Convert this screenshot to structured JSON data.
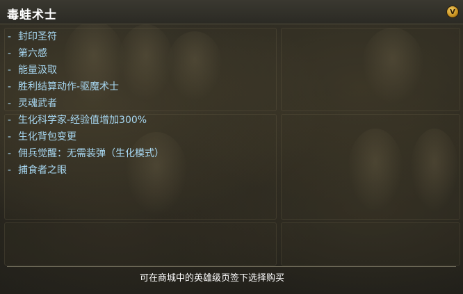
{
  "title": "毒蛙术士",
  "badge": "V",
  "features": [
    "封印圣符",
    "第六感",
    "能量汲取",
    "胜利结算动作-驱魔术士",
    "灵魂武者",
    "生化科学家-经验值增加300%",
    "生化背包变更",
    "佣兵觉醒：无需装弹（生化模式）",
    "捕食者之眼"
  ],
  "bullet": "-",
  "footer": "可在商城中的英雄级页签下选择购买",
  "colors": {
    "title": "#ffffff",
    "feature_text": "#a8d8f2",
    "footer_text": "#ffffff",
    "badge": "#d9a93a"
  }
}
